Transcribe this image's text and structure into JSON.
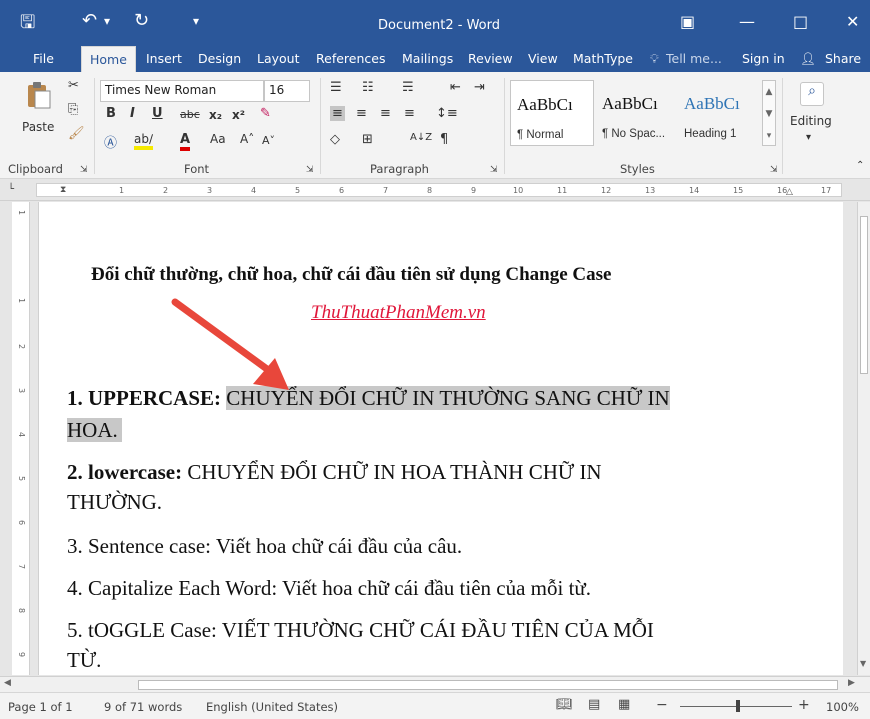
{
  "window": {
    "title": "Document2 - Word",
    "save_icon": "🖫",
    "undo_icon": "↶",
    "redo_icon": "↻",
    "qa_dropdown_icon": "▾",
    "ribbon_display_icon": "▣",
    "minimize_icon": "—",
    "maximize_icon": "□",
    "close_icon": "✕"
  },
  "tabs": {
    "file": "File",
    "home": "Home",
    "insert": "Insert",
    "design": "Design",
    "layout": "Layout",
    "references": "References",
    "mailings": "Mailings",
    "review": "Review",
    "view": "View",
    "mathtype": "MathType",
    "tell_me": "Tell me...",
    "sign_in": "Sign in",
    "share": "Share"
  },
  "ribbon": {
    "paste_label": "Paste",
    "clipboard_label": "Clipboard",
    "font_label": "Font",
    "paragraph_label": "Paragraph",
    "styles_label": "Styles",
    "editing_label": "Editing",
    "font_name": "Times New Roman",
    "font_size": "16",
    "bold": "B",
    "italic": "I",
    "underline": "U",
    "strike": "abc",
    "subscript": "x₂",
    "superscript": "x²",
    "font_color": "A",
    "change_case": "Aa",
    "grow_font": "A˄",
    "shrink_font": "A˅",
    "pilcrow": "¶",
    "sort": "A↓Z",
    "styles": [
      {
        "sample": "AaBbCı",
        "name": "¶ Normal"
      },
      {
        "sample": "AaBbCı",
        "name": "¶ No Spac..."
      },
      {
        "sample": "AaBbCı",
        "name": "Heading 1"
      }
    ]
  },
  "document": {
    "heading": "Đổi chữ thường, chữ hoa, chữ cái đầu tiên sử dụng Change Case",
    "link": "ThuThuatPhanMem.vn",
    "line1_label": "1. UPPERCASE:",
    "line1_text_a": "CHUYỂN ĐỔI CHỮ IN THƯỜNG SANG CHỮ IN",
    "line1_text_b": "HOA.",
    "line2_label": "2. lowercase:",
    "line2_text_a": "CHUYỂN ĐỔI CHỮ IN HOA THÀNH CHỮ IN",
    "line2_text_b": "THƯỜNG.",
    "line3": "3. Sentence case: Viết hoa chữ cái đầu của câu.",
    "line4": "4. Capitalize Each Word: Viết hoa chữ cái đầu tiên của mỗi từ.",
    "line5_a": "5. tOGGLE Case: VIẾT THƯỜNG CHỮ CÁI ĐẦU TIÊN CỦA MỖI",
    "line5_b": "TỪ."
  },
  "status": {
    "page": "Page 1 of 1",
    "words": "9 of 71 words",
    "language": "English (United States)",
    "zoom": "100%",
    "zoom_minus": "−",
    "zoom_plus": "+"
  },
  "colors": {
    "title_bar": "#2b579a",
    "arrow": "#e8473b",
    "link": "#e0173a",
    "selection": "#c8c8c8"
  }
}
